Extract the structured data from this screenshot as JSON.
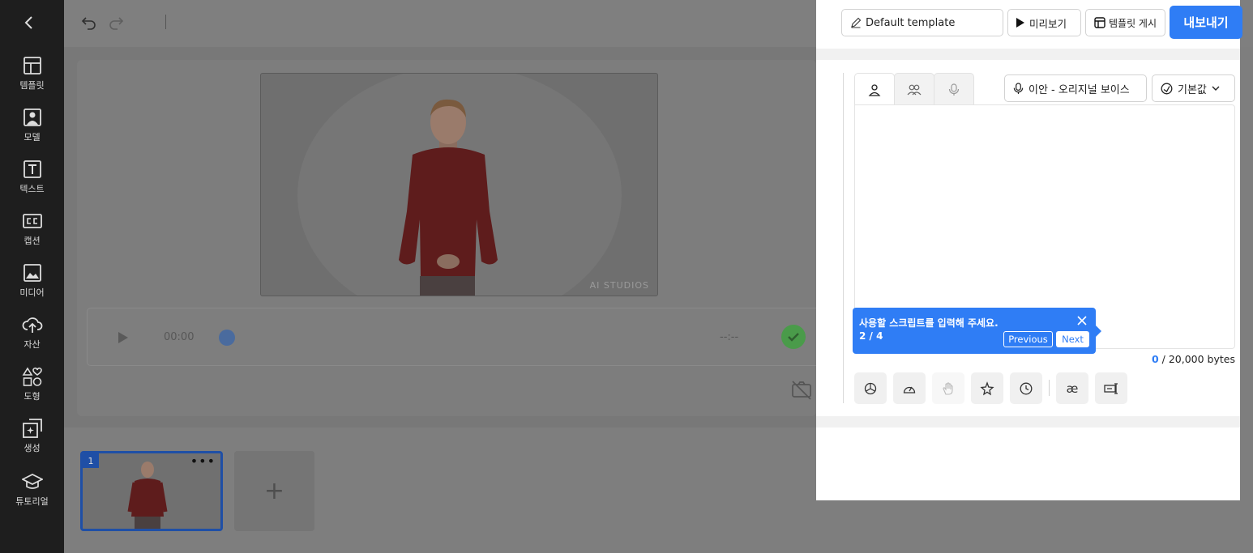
{
  "sidebar": {
    "items": [
      {
        "label": "템플릿",
        "icon": "template-icon"
      },
      {
        "label": "모델",
        "icon": "model-icon"
      },
      {
        "label": "텍스트",
        "icon": "text-icon"
      },
      {
        "label": "캡션",
        "icon": "caption-icon"
      },
      {
        "label": "미디어",
        "icon": "media-icon"
      },
      {
        "label": "자산",
        "icon": "upload-cloud-icon"
      },
      {
        "label": "도형",
        "icon": "shapes-icon"
      },
      {
        "label": "생성",
        "icon": "generate-icon"
      },
      {
        "label": "튜토리얼",
        "icon": "graduation-cap-icon"
      }
    ]
  },
  "header": {
    "template_name": "Default template",
    "preview_label": "미리보기",
    "post_template_label": "템플릿 게시",
    "export_label": "내보내기"
  },
  "player": {
    "current_time": "00:00",
    "total_time": "--:--"
  },
  "canvas": {
    "watermark": "AI STUDIOS"
  },
  "scenes": {
    "items": [
      {
        "number": "1",
        "more": "•••"
      }
    ],
    "add_label": "+"
  },
  "script_panel": {
    "voice_label": "이안 - 오리지널 보이스",
    "style_label": "기본값",
    "bytes_used": "0",
    "bytes_limit": "/ 20,000 bytes",
    "tool_ipa": "æ"
  },
  "tooltip": {
    "message": "사용할 스크립트를 입력해 주세요.",
    "step": "2 / 4",
    "previous_label": "Previous",
    "next_label": "Next"
  },
  "colors": {
    "accent": "#2f7df5",
    "sidebar_bg": "#1e1e1e",
    "overlay": "#7e7e7e"
  }
}
